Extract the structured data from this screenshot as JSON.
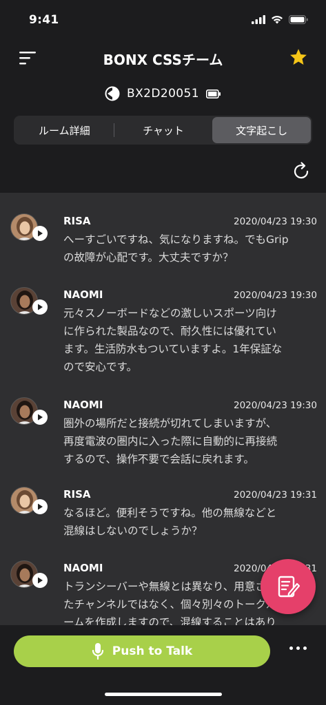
{
  "status": {
    "time": "9:41"
  },
  "header": {
    "title": "BONX CSSチーム"
  },
  "device": {
    "name": "BX2D20051"
  },
  "tabs": [
    {
      "label": "ルーム詳細",
      "active": false
    },
    {
      "label": "チャット",
      "active": false
    },
    {
      "label": "文字起こし",
      "active": true
    }
  ],
  "messages": [
    {
      "name": "RISA",
      "time": "2020/04/23 19:30",
      "lines": [
        "へーすごいですね、気になりますね。でもGrip",
        "の故障が心配です。大丈夫ですか？"
      ]
    },
    {
      "name": "NAOMI",
      "time": "2020/04/23 19:30",
      "lines": [
        "元々スノーボードなどの激しいスポーツ向け",
        "に作られた製品なので、耐久性には優れてい",
        "ます。生活防水もついていますよ。1年保証な",
        "ので安心です。"
      ]
    },
    {
      "name": "NAOMI",
      "time": "2020/04/23 19:30",
      "lines": [
        "圏外の場所だと接続が切れてしまいますが、",
        "再度電波の圏内に入った際に自動的に再接続",
        "するので、操作不要で会話に戻れます。"
      ]
    },
    {
      "name": "RISA",
      "time": "2020/04/23 19:31",
      "lines": [
        "なるほど。便利そうですね。他の無線などと",
        "混線はしないのでしょうか？"
      ]
    },
    {
      "name": "NAOMI",
      "time": "2020/04/23 19:31",
      "lines": [
        "トランシーバーや無線とは異なり、用意され",
        "たチャンネルではなく、個々別々のトークル",
        "ームを作成しますので、混線することはあり"
      ]
    }
  ],
  "ptt": {
    "label": "Push to Talk"
  },
  "colors": {
    "accent_green": "#a8d04a",
    "fab_pink": "#e5406a",
    "star_yellow": "#f5c518"
  }
}
